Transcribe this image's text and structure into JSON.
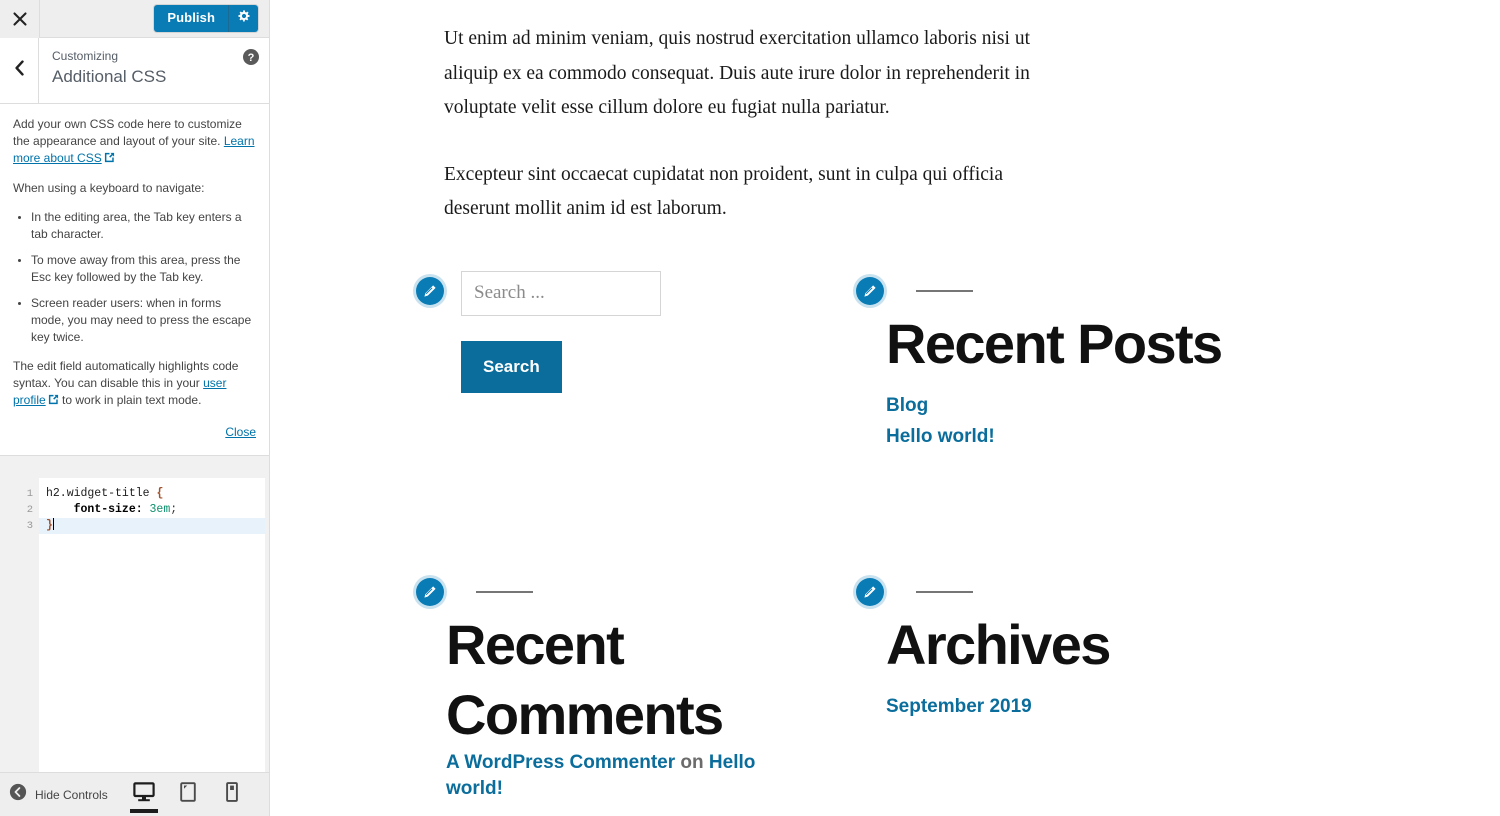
{
  "sidebar": {
    "close_icon": "close-x-icon",
    "publish_label": "Publish",
    "gear_icon": "gear-icon",
    "back_icon": "chevron-left-icon",
    "eyebrow": "Customizing",
    "panel_title": "Additional CSS",
    "help_icon": "help-circle-icon",
    "description": {
      "intro": "Add your own CSS code here to customize the appearance and layout of your site.",
      "learn_more_link": "Learn more about CSS",
      "keyboard_intro": "When using a keyboard to navigate:",
      "bullets": [
        "In the editing area, the Tab key enters a tab character.",
        "To move away from this area, press the Esc key followed by the Tab key.",
        "Screen reader users: when in forms mode, you may need to press the escape key twice."
      ],
      "syntax_pre": "The edit field automatically highlights code syntax. You can disable this in your ",
      "syntax_link": "user profile",
      "syntax_post": " to work in plain text mode.",
      "close_label": "Close"
    },
    "editor": {
      "line_numbers": [
        "1",
        "2",
        "3"
      ],
      "lines": [
        {
          "selector": "h2.widget-title",
          "space": " ",
          "brace": "{"
        },
        {
          "indent": "    ",
          "prop": "font-size:",
          "space": " ",
          "value": "3em",
          "punc": ";"
        },
        {
          "brace": "}"
        }
      ],
      "active_line_index": 2
    },
    "footer": {
      "hide_controls_label": "Hide Controls",
      "collapse_icon": "collapse-left-icon",
      "devices": [
        {
          "name": "desktop-preview",
          "icon": "desktop-icon",
          "active": true
        },
        {
          "name": "tablet-preview",
          "icon": "tablet-icon",
          "active": false
        },
        {
          "name": "mobile-preview",
          "icon": "mobile-icon",
          "active": false
        }
      ]
    }
  },
  "preview": {
    "paragraphs": [
      "Ut enim ad minim veniam, quis nostrud exercitation ullamco laboris nisi ut aliquip ex ea commodo consequat. Duis aute irure dolor in reprehenderit in voluptate velit esse cillum dolore eu fugiat nulla pariatur.",
      "Excepteur sint occaecat cupidatat non proident, sunt in culpa qui officia deserunt mollit anim id est laborum."
    ],
    "search_widget": {
      "edit_icon": "edit-pencil-icon",
      "placeholder": "Search ...",
      "value": "",
      "button_label": "Search"
    },
    "recent_posts": {
      "edit_icon": "edit-pencil-icon",
      "title": "Recent Posts",
      "links": [
        "Blog",
        "Hello world!"
      ]
    },
    "recent_comments": {
      "edit_icon": "edit-pencil-icon",
      "title": "Recent Comments",
      "author": "A WordPress Commenter",
      "separator": " on ",
      "post": "Hello world!"
    },
    "archives": {
      "edit_icon": "edit-pencil-icon",
      "title": "Archives",
      "links": [
        "September 2019"
      ]
    }
  },
  "colors": {
    "accent_blue": "#0a7cb5",
    "link_blue": "#0a6d9b",
    "sidebar_bg": "#ffffff",
    "topbar_bg": "#eeeeee",
    "editor_gutter": "#f1f1f1",
    "active_line": "#e8f2fa"
  }
}
